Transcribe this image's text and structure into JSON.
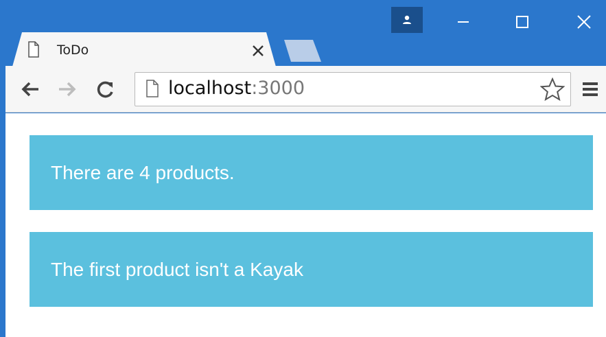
{
  "tab": {
    "title": "ToDo"
  },
  "address_bar": {
    "host": "localhost",
    "port": ":3000"
  },
  "colors": {
    "titlebar": "#2b77cc",
    "panel": "#5bc0de",
    "panel_text": "#ffffff"
  },
  "icons": {
    "profile": "person-icon",
    "minimize": "minimize-icon",
    "maximize": "maximize-icon",
    "close": "close-icon",
    "tab_page": "page-icon",
    "back": "back-arrow-icon",
    "forward": "forward-arrow-icon",
    "reload": "reload-icon",
    "bookmark": "star-icon",
    "menu": "hamburger-menu-icon"
  },
  "main": {
    "panels": [
      {
        "text": "There are 4 products."
      },
      {
        "text": "The first product isn't a Kayak"
      }
    ]
  }
}
